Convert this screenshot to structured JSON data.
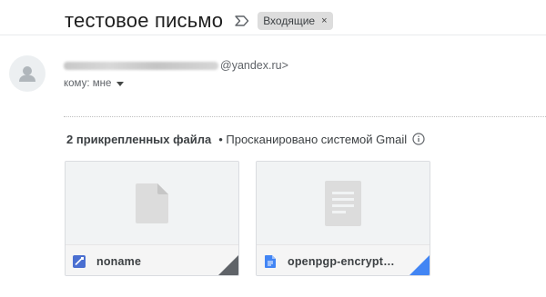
{
  "email": {
    "subject": "тестовое письмо",
    "label": "Входящие",
    "label_close": "×"
  },
  "sender": {
    "domain": "@yandex.ru>",
    "recipient": "кому: мне"
  },
  "attachments": {
    "count_label": "2 прикрепленных файла",
    "scan_note": "• Просканировано системой Gmail",
    "items": [
      {
        "name": "noname",
        "icon": "image-file-icon",
        "color": "#5b7fdb"
      },
      {
        "name": "openpgp-encrypt…",
        "icon": "docs-file-icon",
        "color": "#4285f4"
      }
    ]
  },
  "colors": {
    "chip_bg": "#dddddd",
    "docs_blue": "#4285f4",
    "preview_bg": "#f1f3f4"
  }
}
